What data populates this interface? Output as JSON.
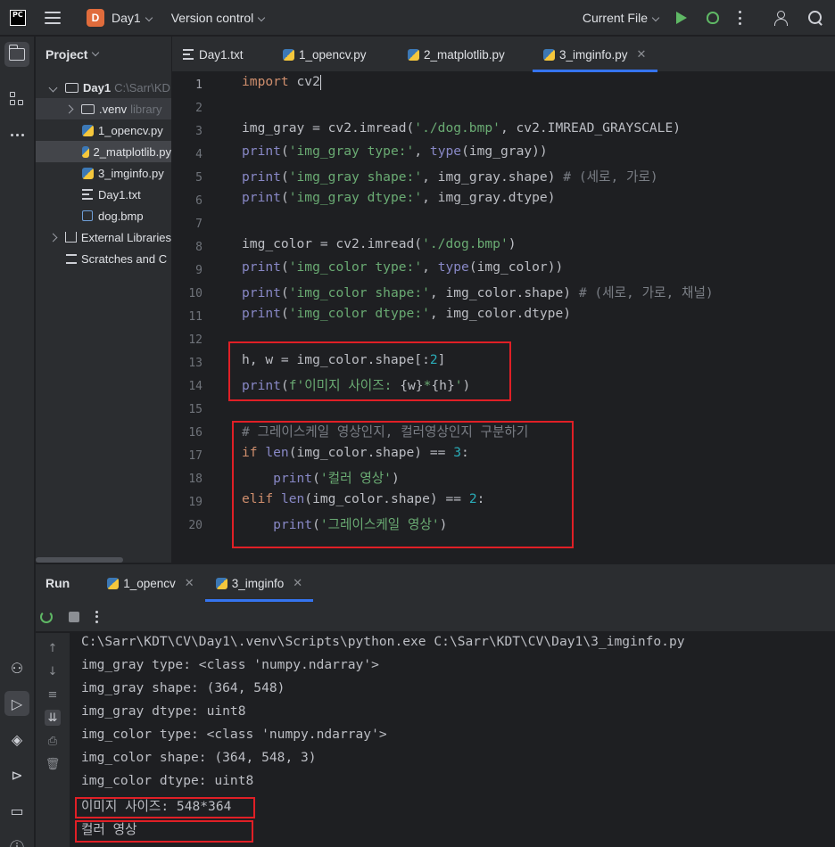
{
  "titlebar": {
    "project_badge": "D",
    "project_name": "Day1",
    "vcs_label": "Version control",
    "run_config": "Current File"
  },
  "project_pane": {
    "title": "Project",
    "tree": [
      {
        "label": "Day1",
        "hint": "C:\\Sarr\\KD"
      },
      {
        "label": ".venv",
        "hint": "library"
      },
      {
        "label": "1_opencv.py"
      },
      {
        "label": "2_matplotlib.py"
      },
      {
        "label": "3_imginfo.py"
      },
      {
        "label": "Day1.txt"
      },
      {
        "label": "dog.bmp"
      },
      {
        "label": "External Libraries"
      },
      {
        "label": "Scratches and C"
      }
    ]
  },
  "editor": {
    "tabs": [
      "Day1.txt",
      "1_opencv.py",
      "2_matplotlib.py",
      "3_imginfo.py"
    ],
    "active_tab": "3_imginfo.py",
    "line_numbers": [
      "1",
      "2",
      "3",
      "4",
      "5",
      "6",
      "7",
      "8",
      "9",
      "10",
      "11",
      "12",
      "13",
      "14",
      "15",
      "16",
      "17",
      "18",
      "19",
      "20"
    ]
  },
  "run_panel": {
    "title": "Run",
    "tabs": [
      "1_opencv",
      "3_imginfo"
    ],
    "output": [
      "C:\\Sarr\\KDT\\CV\\Day1\\.venv\\Scripts\\python.exe C:\\Sarr\\KDT\\CV\\Day1\\3_imginfo.py",
      "img_gray type: <class 'numpy.ndarray'>",
      "img_gray shape: (364, 548)",
      "img_gray dtype: uint8",
      "img_color type: <class 'numpy.ndarray'>",
      "img_color shape: (364, 548, 3)",
      "img_color dtype: uint8",
      "이미지 사이즈: 548*364",
      "컬러 영상"
    ]
  },
  "colors": {
    "accent": "#3574f0",
    "highlight_box": "#e01f26",
    "run_green": "#5fb865",
    "project_badge": "#e06c3c"
  }
}
